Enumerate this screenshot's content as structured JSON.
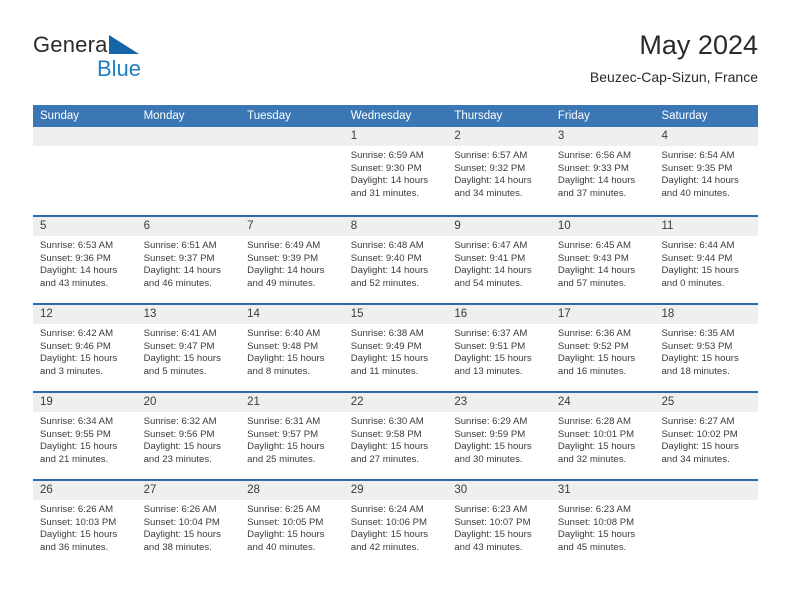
{
  "brand": {
    "name_top": "General",
    "name_bottom": "Blue"
  },
  "header": {
    "title": "May 2024",
    "subtitle": "Beuzec-Cap-Sizun, France"
  },
  "colors": {
    "header_blue": "#3b77b5",
    "row_divider_blue": "#2f6cab",
    "day_band_gray": "#efefef",
    "brand_blue": "#1f7fc4"
  },
  "weekdays": [
    "Sunday",
    "Monday",
    "Tuesday",
    "Wednesday",
    "Thursday",
    "Friday",
    "Saturday"
  ],
  "weeks": [
    [
      {
        "day": ""
      },
      {
        "day": ""
      },
      {
        "day": ""
      },
      {
        "day": "1",
        "sunrise": "Sunrise: 6:59 AM",
        "sunset": "Sunset: 9:30 PM",
        "daylight": "Daylight: 14 hours and 31 minutes."
      },
      {
        "day": "2",
        "sunrise": "Sunrise: 6:57 AM",
        "sunset": "Sunset: 9:32 PM",
        "daylight": "Daylight: 14 hours and 34 minutes."
      },
      {
        "day": "3",
        "sunrise": "Sunrise: 6:56 AM",
        "sunset": "Sunset: 9:33 PM",
        "daylight": "Daylight: 14 hours and 37 minutes."
      },
      {
        "day": "4",
        "sunrise": "Sunrise: 6:54 AM",
        "sunset": "Sunset: 9:35 PM",
        "daylight": "Daylight: 14 hours and 40 minutes."
      }
    ],
    [
      {
        "day": "5",
        "sunrise": "Sunrise: 6:53 AM",
        "sunset": "Sunset: 9:36 PM",
        "daylight": "Daylight: 14 hours and 43 minutes."
      },
      {
        "day": "6",
        "sunrise": "Sunrise: 6:51 AM",
        "sunset": "Sunset: 9:37 PM",
        "daylight": "Daylight: 14 hours and 46 minutes."
      },
      {
        "day": "7",
        "sunrise": "Sunrise: 6:49 AM",
        "sunset": "Sunset: 9:39 PM",
        "daylight": "Daylight: 14 hours and 49 minutes."
      },
      {
        "day": "8",
        "sunrise": "Sunrise: 6:48 AM",
        "sunset": "Sunset: 9:40 PM",
        "daylight": "Daylight: 14 hours and 52 minutes."
      },
      {
        "day": "9",
        "sunrise": "Sunrise: 6:47 AM",
        "sunset": "Sunset: 9:41 PM",
        "daylight": "Daylight: 14 hours and 54 minutes."
      },
      {
        "day": "10",
        "sunrise": "Sunrise: 6:45 AM",
        "sunset": "Sunset: 9:43 PM",
        "daylight": "Daylight: 14 hours and 57 minutes."
      },
      {
        "day": "11",
        "sunrise": "Sunrise: 6:44 AM",
        "sunset": "Sunset: 9:44 PM",
        "daylight": "Daylight: 15 hours and 0 minutes."
      }
    ],
    [
      {
        "day": "12",
        "sunrise": "Sunrise: 6:42 AM",
        "sunset": "Sunset: 9:46 PM",
        "daylight": "Daylight: 15 hours and 3 minutes."
      },
      {
        "day": "13",
        "sunrise": "Sunrise: 6:41 AM",
        "sunset": "Sunset: 9:47 PM",
        "daylight": "Daylight: 15 hours and 5 minutes."
      },
      {
        "day": "14",
        "sunrise": "Sunrise: 6:40 AM",
        "sunset": "Sunset: 9:48 PM",
        "daylight": "Daylight: 15 hours and 8 minutes."
      },
      {
        "day": "15",
        "sunrise": "Sunrise: 6:38 AM",
        "sunset": "Sunset: 9:49 PM",
        "daylight": "Daylight: 15 hours and 11 minutes."
      },
      {
        "day": "16",
        "sunrise": "Sunrise: 6:37 AM",
        "sunset": "Sunset: 9:51 PM",
        "daylight": "Daylight: 15 hours and 13 minutes."
      },
      {
        "day": "17",
        "sunrise": "Sunrise: 6:36 AM",
        "sunset": "Sunset: 9:52 PM",
        "daylight": "Daylight: 15 hours and 16 minutes."
      },
      {
        "day": "18",
        "sunrise": "Sunrise: 6:35 AM",
        "sunset": "Sunset: 9:53 PM",
        "daylight": "Daylight: 15 hours and 18 minutes."
      }
    ],
    [
      {
        "day": "19",
        "sunrise": "Sunrise: 6:34 AM",
        "sunset": "Sunset: 9:55 PM",
        "daylight": "Daylight: 15 hours and 21 minutes."
      },
      {
        "day": "20",
        "sunrise": "Sunrise: 6:32 AM",
        "sunset": "Sunset: 9:56 PM",
        "daylight": "Daylight: 15 hours and 23 minutes."
      },
      {
        "day": "21",
        "sunrise": "Sunrise: 6:31 AM",
        "sunset": "Sunset: 9:57 PM",
        "daylight": "Daylight: 15 hours and 25 minutes."
      },
      {
        "day": "22",
        "sunrise": "Sunrise: 6:30 AM",
        "sunset": "Sunset: 9:58 PM",
        "daylight": "Daylight: 15 hours and 27 minutes."
      },
      {
        "day": "23",
        "sunrise": "Sunrise: 6:29 AM",
        "sunset": "Sunset: 9:59 PM",
        "daylight": "Daylight: 15 hours and 30 minutes."
      },
      {
        "day": "24",
        "sunrise": "Sunrise: 6:28 AM",
        "sunset": "Sunset: 10:01 PM",
        "daylight": "Daylight: 15 hours and 32 minutes."
      },
      {
        "day": "25",
        "sunrise": "Sunrise: 6:27 AM",
        "sunset": "Sunset: 10:02 PM",
        "daylight": "Daylight: 15 hours and 34 minutes."
      }
    ],
    [
      {
        "day": "26",
        "sunrise": "Sunrise: 6:26 AM",
        "sunset": "Sunset: 10:03 PM",
        "daylight": "Daylight: 15 hours and 36 minutes."
      },
      {
        "day": "27",
        "sunrise": "Sunrise: 6:26 AM",
        "sunset": "Sunset: 10:04 PM",
        "daylight": "Daylight: 15 hours and 38 minutes."
      },
      {
        "day": "28",
        "sunrise": "Sunrise: 6:25 AM",
        "sunset": "Sunset: 10:05 PM",
        "daylight": "Daylight: 15 hours and 40 minutes."
      },
      {
        "day": "29",
        "sunrise": "Sunrise: 6:24 AM",
        "sunset": "Sunset: 10:06 PM",
        "daylight": "Daylight: 15 hours and 42 minutes."
      },
      {
        "day": "30",
        "sunrise": "Sunrise: 6:23 AM",
        "sunset": "Sunset: 10:07 PM",
        "daylight": "Daylight: 15 hours and 43 minutes."
      },
      {
        "day": "31",
        "sunrise": "Sunrise: 6:23 AM",
        "sunset": "Sunset: 10:08 PM",
        "daylight": "Daylight: 15 hours and 45 minutes."
      },
      {
        "day": ""
      }
    ]
  ]
}
